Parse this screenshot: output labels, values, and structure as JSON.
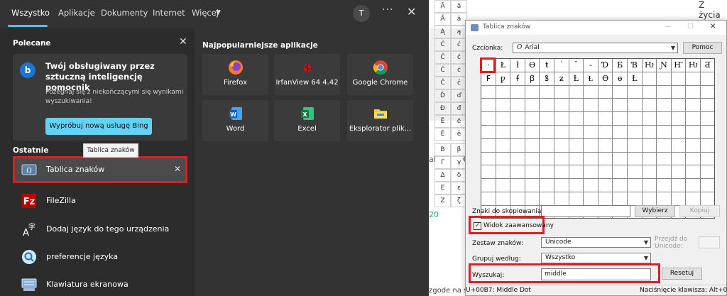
{
  "search": {
    "tabs": [
      "Wszystko",
      "Aplikacje",
      "Dokumenty",
      "Internet",
      "Więcej"
    ],
    "avatar_letter": "T",
    "more_options": "···",
    "close_glyph": "✕",
    "recommended_title": "Polecane",
    "bing": {
      "title": "Twój obsługiwany przez sztuczną inteligencję pomocnik",
      "description": "Pożegnaj się z niekończącymi się wynikami wyszukiwania!",
      "button": "Wypróbuj nową usługę Bing"
    },
    "recent_title": "Ostatnie",
    "tooltip": "Tablica znaków",
    "recent_items": [
      {
        "label": "Tablica znaków",
        "icon": "charmap-icon"
      },
      {
        "label": "FileZilla",
        "icon": "filezilla-icon"
      },
      {
        "label": "Dodaj język do tego urządzenia",
        "icon": "language-icon"
      },
      {
        "label": "preferencje języka",
        "icon": "search-icon"
      },
      {
        "label": "Klawiatura ekranowa",
        "icon": "keyboard-icon"
      }
    ],
    "top_apps_title": "Najpopularniejsze aplikacje",
    "top_apps": [
      {
        "label": "Firefox",
        "icon": "firefox-icon"
      },
      {
        "label": "IrfanView 64 4.42",
        "icon": "irfanview-icon"
      },
      {
        "label": "Google Chrome",
        "icon": "chrome-icon"
      },
      {
        "label": "Word",
        "icon": "word-icon"
      },
      {
        "label": "Excel",
        "icon": "excel-icon"
      },
      {
        "label": "Eksplorator plik...",
        "icon": "file-explorer-icon"
      }
    ]
  },
  "document": {
    "top_right_text": "Z życia",
    "glyph_table": [
      "Ā",
      "ā",
      "Ă",
      "ă",
      "Ą",
      "ą",
      "Ć",
      "ć",
      "Ĉ",
      "ĉ",
      "Ċ",
      "ċ",
      "Č",
      "č",
      "Ď",
      "ď",
      "Đ",
      "đ",
      "Ē",
      "ē",
      "Ĕ",
      "ĕ"
    ],
    "glyph_table_lower": [
      "Β",
      "β",
      "Γ",
      "γ",
      "Δ",
      "δ",
      "Ε",
      "ε",
      "Ζ",
      "ζ"
    ],
    "fragment_a": "al",
    "fragment_b": "€",
    "fragment_c": "20",
    "bottom_text": "zgode na s"
  },
  "charmap": {
    "title": "Tablica znaków",
    "font_label": "Czcionka:",
    "font_value": "Arial",
    "help_button": "Pomoc",
    "characters_row1": [
      "·",
      "Ł",
      "ł",
      "Ө",
      "ŧ",
      "˙",
      "˘",
      "‐",
      "Ɗ",
      "Ƃ",
      "Ɓ",
      "Ƕ",
      "Ɲ",
      "Ҥ",
      "Ƕ",
      "Ƌ",
      "ƌ",
      "ƒ",
      "Ꞙ"
    ],
    "characters_row2": [
      "Ꞙ",
      "ƿ",
      "ꞙ",
      "ꞵ",
      "ꝸ",
      "ƶ",
      "Ƚ",
      "Ɫ",
      "Ɵ",
      "ɵ",
      "Ƚ"
    ],
    "copy_label": "Znaki do skopiowania:",
    "copy_value": "",
    "select_button": "Wybierz",
    "copy_button": "Kopiuj",
    "advanced_label": "Widok zaawansowany",
    "advanced_checked": "✓",
    "charset_label": "Zestaw znaków:",
    "charset_value": "Unicode",
    "goto_label": "Przejdź do Unicode:",
    "group_label": "Grupuj według:",
    "group_value": "Wszystko",
    "search_label": "Wyszukaj:",
    "search_value": "middle",
    "reset_button": "Resetuj",
    "status_left": "U+00B7: Middle Dot",
    "status_right": "Naciśnięcie klawisza: Alt+0183"
  },
  "colors": {
    "flyout_bg": "#333333",
    "accent": "#4cc2ff",
    "highlight_red": "#e31b23",
    "bing_button": "#63d2f4"
  }
}
